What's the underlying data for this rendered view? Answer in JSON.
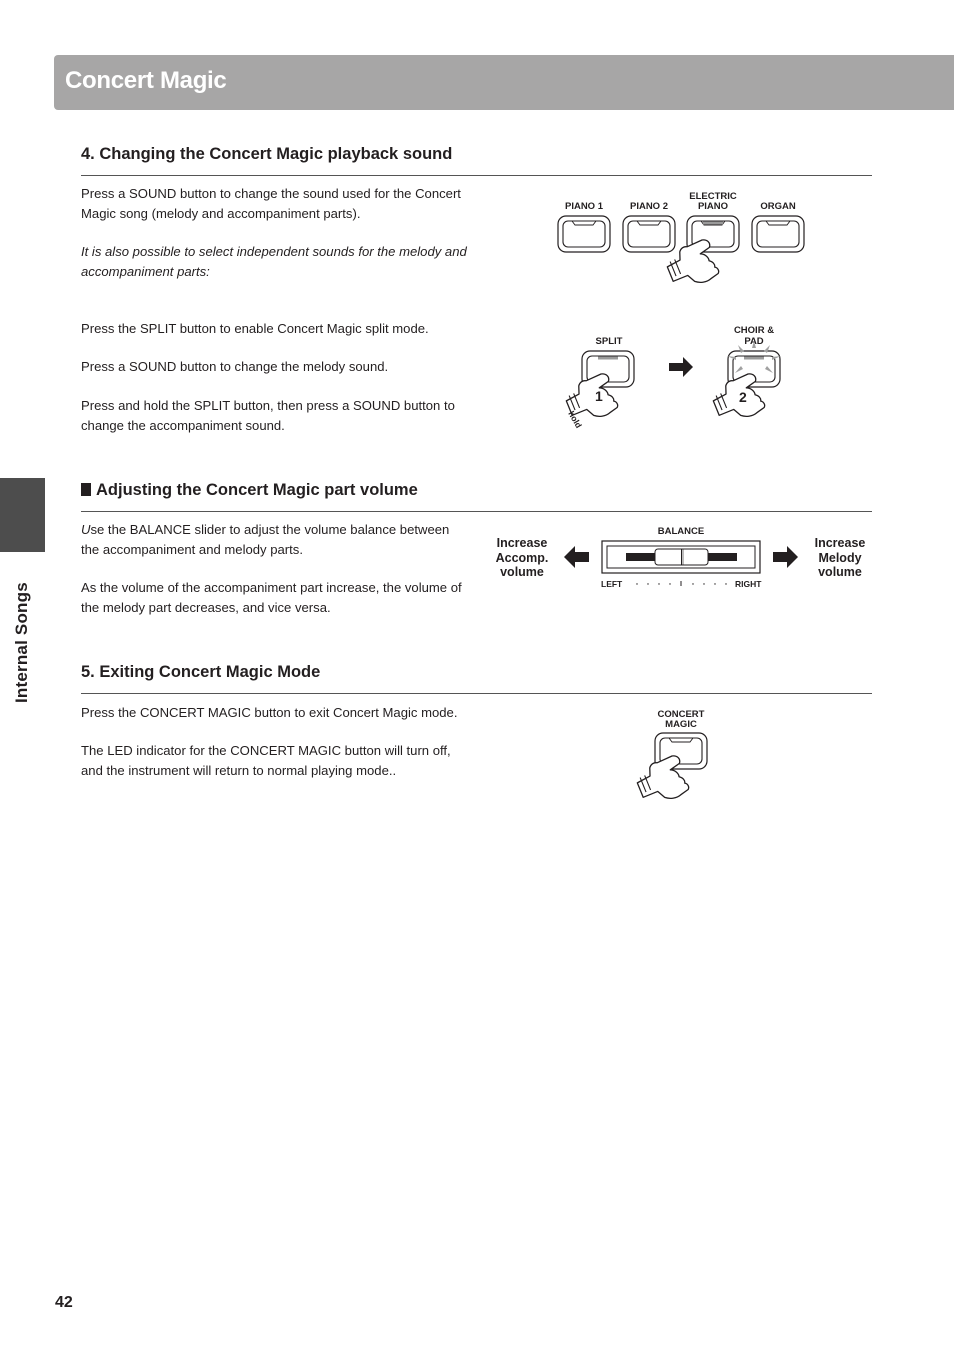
{
  "header": {
    "title": "Concert Magic"
  },
  "side_tab": {
    "label": "Internal Songs"
  },
  "sections": [
    {
      "title": "4. Changing the Concert Magic playback sound",
      "paragraphs": [
        "Press a SOUND button to change the sound used for the Concert Magic song (melody and accompaniment parts).",
        "It is also possible to select independent sounds for the melody and accompaniment parts:",
        "Press the SPLIT button to enable Concert Magic split mode.",
        "Press a SOUND button to change the melody sound.",
        "Press and hold the SPLIT button, then press a SOUND button to change the accompaniment sound."
      ],
      "figure_sound_buttons": {
        "buttons": [
          {
            "label_line1": "",
            "label_line2": "PIANO 1",
            "led_on": false
          },
          {
            "label_line1": "",
            "label_line2": "PIANO 2",
            "led_on": false
          },
          {
            "label_line1": "ELECTRIC",
            "label_line2": "PIANO",
            "led_on": true,
            "pressed": true
          },
          {
            "label_line1": "",
            "label_line2": "ORGAN",
            "led_on": false
          }
        ]
      },
      "figure_split": {
        "step1": {
          "button_label": "SPLIT",
          "step_number": "1",
          "hold_text": "hold",
          "icon": "hand-pressing-icon"
        },
        "arrow": "arrow-right-icon",
        "step2": {
          "button_label_line1": "CHOIR &",
          "button_label_line2": "PAD",
          "step_number": "2",
          "icon": "hand-pressing-icon",
          "flashing": true
        }
      }
    },
    {
      "title": "Adjusting the Concert Magic part volume",
      "paragraphs": [
        {
          "italic_prefix": "U",
          "text": "se the BALANCE slider to adjust the volume balance between the accompaniment and melody parts."
        },
        "As the volume of the accompaniment part increase, the volume of the melody part decreases, and vice versa."
      ],
      "figure_balance": {
        "slider_label": "BALANCE",
        "left_end_label": "LEFT",
        "right_end_label": "RIGHT",
        "slider_position": 0.5,
        "left_caption": [
          "Increase",
          "Accomp.",
          "volume"
        ],
        "right_caption": [
          "Increase",
          "Melody",
          "volume"
        ]
      }
    },
    {
      "title": "5. Exiting Concert Magic Mode",
      "paragraphs": [
        "Press the CONCERT MAGIC button to exit Concert Magic mode.",
        "The LED indicator for the CONCERT MAGIC button will turn off, and the instrument will return to normal playing mode.."
      ],
      "figure_concert_magic": {
        "label_line1": "CONCERT",
        "label_line2": "MAGIC",
        "led_on": false
      }
    }
  ],
  "footer": {
    "page_number": "42"
  },
  "colors": {
    "header_bar": "#a7a6a6",
    "side_tab": "#4d4d4d",
    "text": "#231f20",
    "led": "#9a9a9a"
  }
}
